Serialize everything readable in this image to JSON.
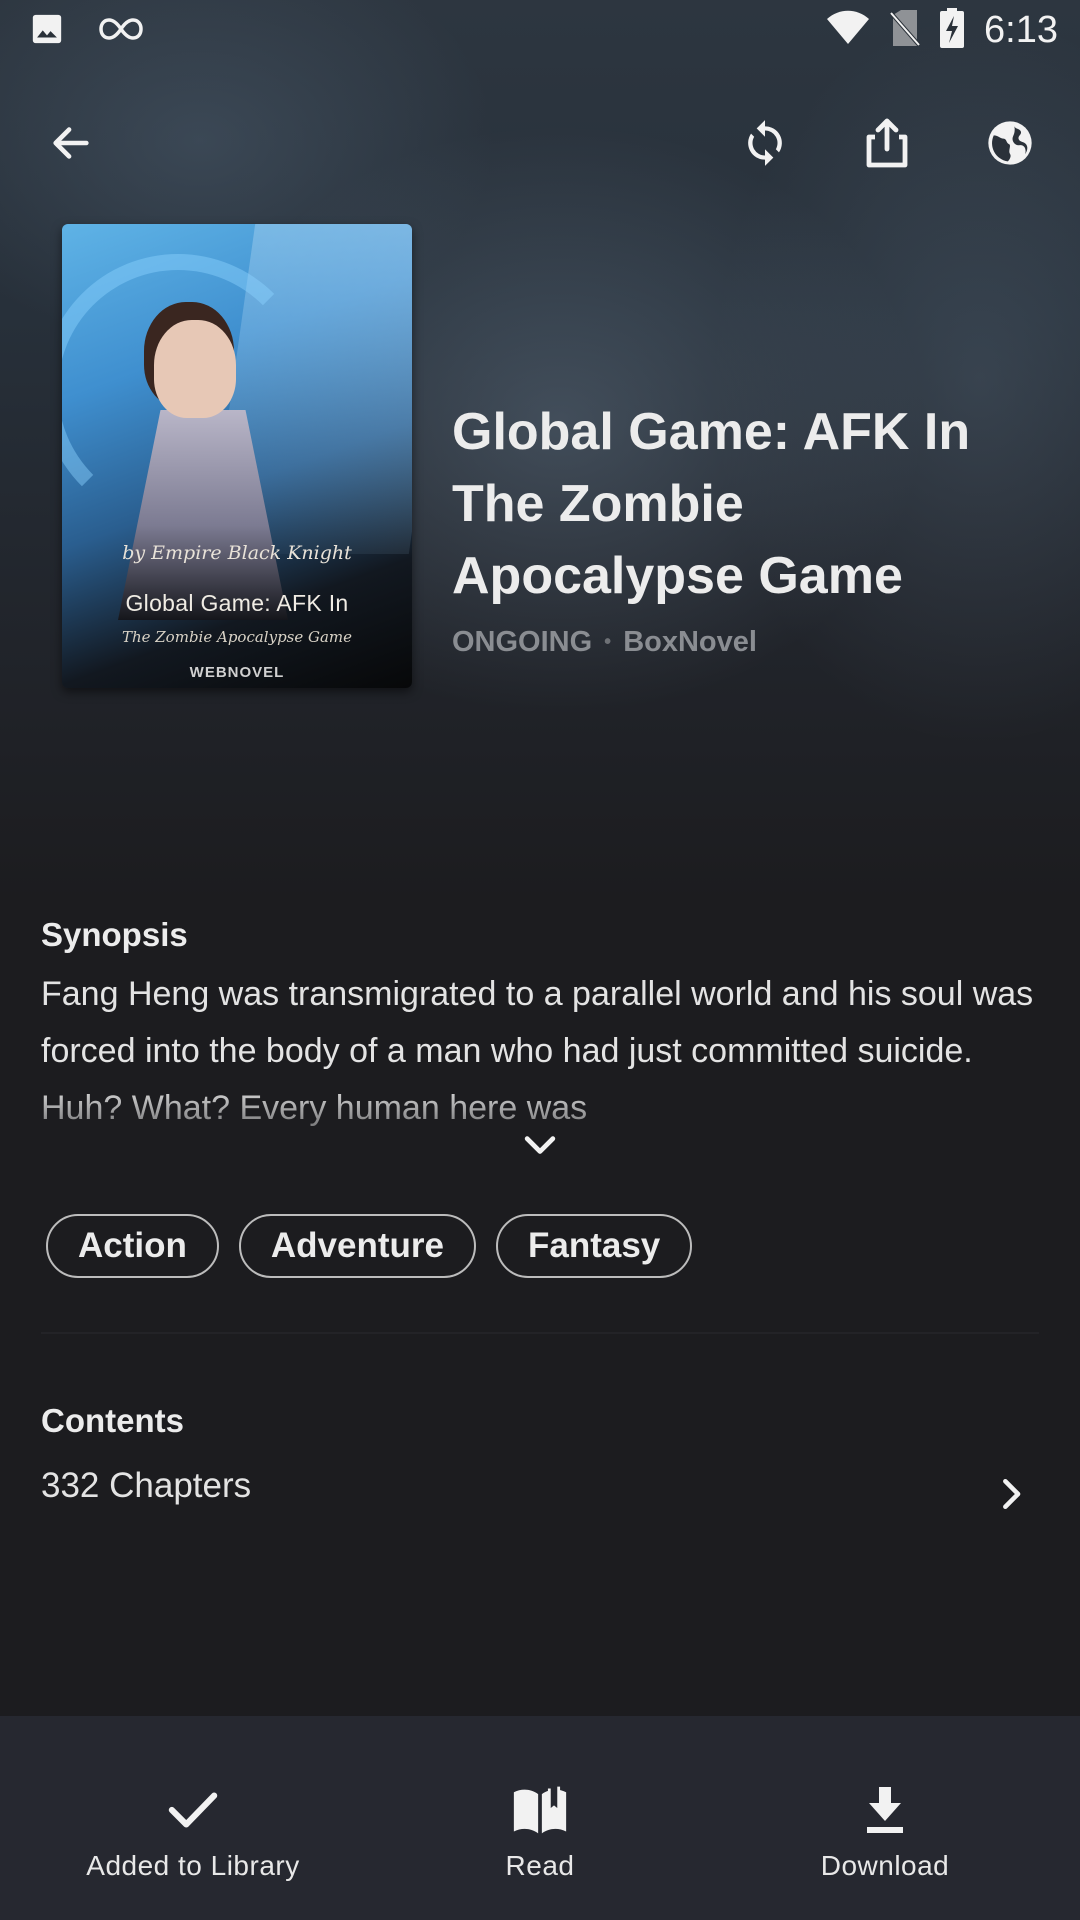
{
  "status_bar": {
    "time": "6:13",
    "icons": [
      "image-icon",
      "infinity-icon",
      "wifi-icon",
      "no-sim-icon",
      "battery-charging-icon"
    ]
  },
  "toolbar": {
    "icons": [
      "back-arrow-icon",
      "refresh-icon",
      "share-icon",
      "globe-icon"
    ]
  },
  "cover": {
    "byline": "by Empire Black Knight",
    "title": "Global Game: AFK In",
    "subtitle": "The Zombie Apocalypse Game",
    "brand": "WEBNOVEL"
  },
  "book": {
    "title": "Global Game: AFK In The Zombie Apocalypse Game",
    "status": "ONGOING",
    "separator": "•",
    "source": "BoxNovel"
  },
  "synopsis": {
    "heading": "Synopsis",
    "text": "Fang Heng was transmigrated to a parallel world and his soul was forced into the body of a man who had just committed suicide. Huh? What? Every human here was"
  },
  "genres": [
    "Action",
    "Adventure",
    "Fantasy"
  ],
  "contents": {
    "heading": "Contents",
    "chapters": "332 Chapters"
  },
  "bottom_bar": {
    "library_label": "Added to Library",
    "read_label": "Read",
    "download_label": "Download"
  },
  "colors": {
    "background": "#1c1c1f",
    "bottom_bar": "#262830",
    "meta_text": "#8a8d92"
  }
}
